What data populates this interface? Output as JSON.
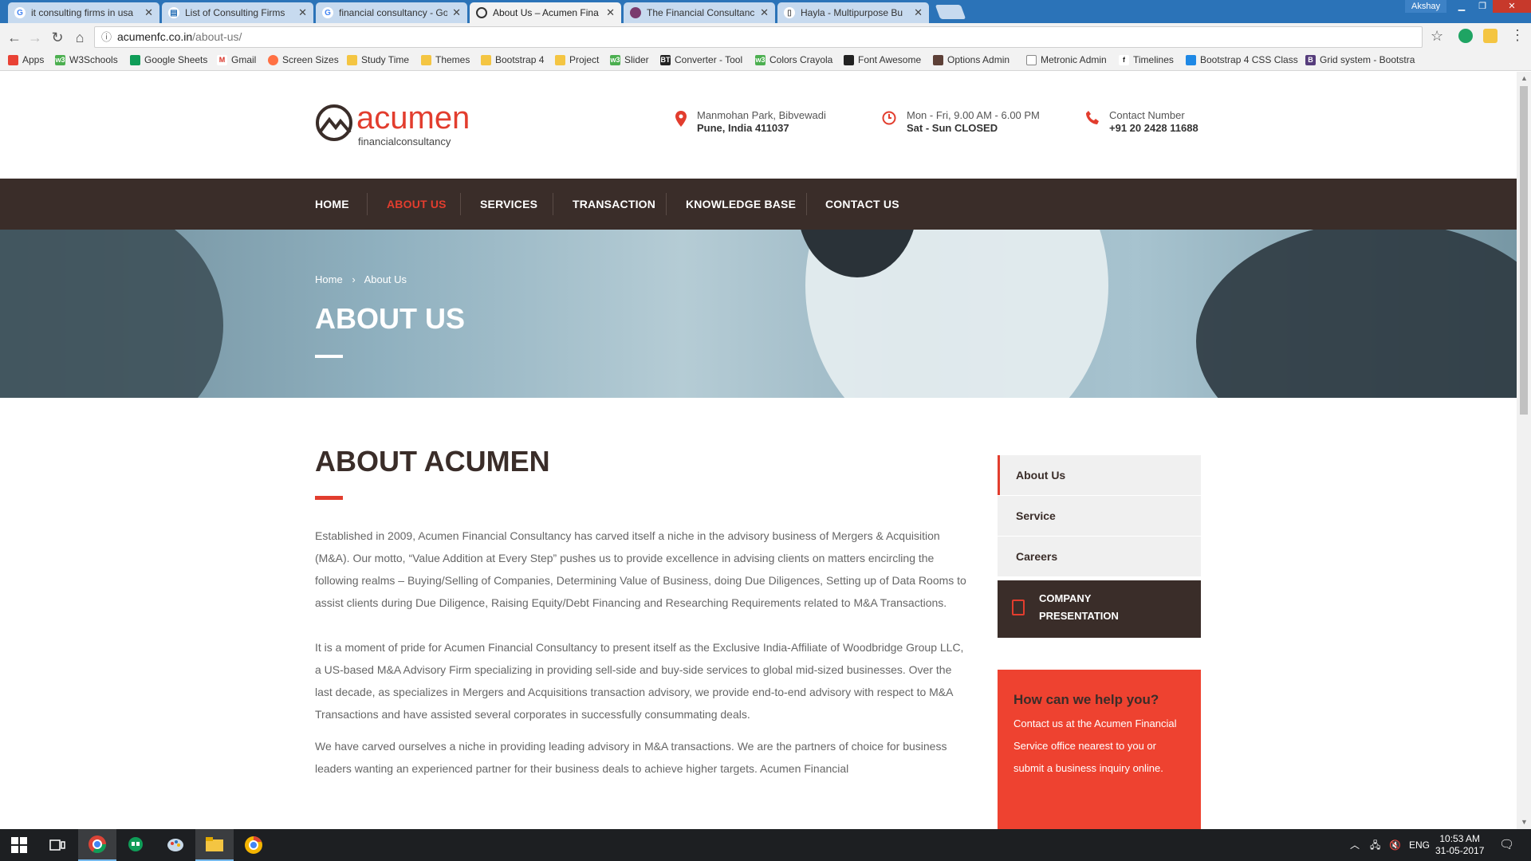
{
  "browser": {
    "tabs": [
      {
        "title": "it consulting firms in usa",
        "favicon": "google-icon"
      },
      {
        "title": "List of Consulting Firms",
        "favicon": "document-icon"
      },
      {
        "title": "financial consultancy - Go",
        "favicon": "google-icon"
      },
      {
        "title": "About Us – Acumen Fina",
        "favicon": "acumen-icon",
        "active": true
      },
      {
        "title": "The Financial Consultanc",
        "favicon": "globe-icon"
      },
      {
        "title": "Hayla - Multipurpose Bu",
        "favicon": "document-icon"
      }
    ],
    "user": "Akshay",
    "url_host": "acumenfc.co.in",
    "url_path": "/about-us/",
    "bookmarks": [
      "Apps",
      "W3Schools",
      "Google Sheets",
      "Gmail",
      "Screen Sizes",
      "Study Time",
      "Themes",
      "Bootstrap 4",
      "Project",
      "Slider",
      "Converter - Tool",
      "Colors Crayola",
      "Font Awesome",
      "Options Admin",
      "Metronic Admin",
      "Timelines",
      "Bootstrap 4 CSS Class",
      "Grid system - Bootstra"
    ]
  },
  "site": {
    "logo_word": "acumen",
    "logo_sub": "financialconsultancy",
    "address_line1": "Manmohan Park, Bibvewadi",
    "address_line2": "Pune, India 411037",
    "hours_line1": "Mon - Fri, 9.00 AM - 6.00 PM",
    "hours_line2": "Sat - Sun CLOSED",
    "contact_line1": "Contact Number",
    "contact_line2": "+91 20 2428 11688",
    "nav": [
      "HOME",
      "ABOUT US",
      "SERVICES",
      "TRANSACTION",
      "KNOWLEDGE BASE",
      "CONTACT US"
    ],
    "nav_active": "ABOUT US",
    "colors": {
      "accent": "#e23d2e",
      "dark": "#3a2d29"
    }
  },
  "hero": {
    "crumb_home": "Home",
    "crumb_sep": "›",
    "crumb_current": "About Us",
    "title": "ABOUT US"
  },
  "content": {
    "heading": "ABOUT ACUMEN",
    "p1": "Established in 2009, Acumen Financial Consultancy has carved itself a niche in the advisory business of Mergers & Acquisition (M&A). Our motto, “Value Addition at Every Step” pushes us to provide excellence in advising clients on matters encircling the following realms – Buying/Selling of Companies, Determining Value of Business, doing Due Diligences, Setting up of Data Rooms to assist clients during Due Diligence, Raising Equity/Debt Financing and Researching Requirements related to M&A Transactions.",
    "p2": "It is a moment of pride for Acumen Financial Consultancy to present itself as the Exclusive India-Affiliate of Woodbridge Group LLC, a US-based M&A Advisory Firm specializing in providing sell-side and buy-side services to global mid-sized businesses. Over the last decade, as specializes in Mergers and Acquisitions transaction advisory, we provide end-to-end advisory with respect to M&A Transactions and have assisted several corporates in successfully consummating deals.",
    "p3": "We have carved ourselves a niche in providing leading advisory in M&A transactions. We are the partners of choice for business leaders wanting an experienced partner for their business deals to achieve higher targets. Acumen Financial"
  },
  "sidebar": {
    "items": [
      "About Us",
      "Service",
      "Careers"
    ],
    "presentation_line1": "COMPANY",
    "presentation_line2": "PRESENTATION",
    "help_title": "How can we help you?",
    "help_body": "Contact us at the Acumen Financial Service office nearest to you or submit a business inquiry online."
  },
  "taskbar": {
    "lang": "ENG",
    "time": "10:53 AM",
    "date": "31-05-2017"
  }
}
